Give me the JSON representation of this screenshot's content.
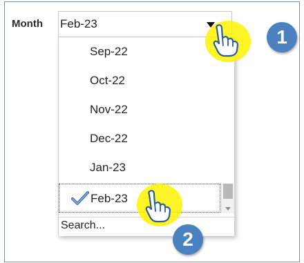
{
  "field": {
    "label": "Month",
    "selected_value": "Feb-23"
  },
  "dropdown": {
    "options": [
      {
        "label": "Sep-22",
        "selected": false
      },
      {
        "label": "Oct-22",
        "selected": false
      },
      {
        "label": "Nov-22",
        "selected": false
      },
      {
        "label": "Dec-22",
        "selected": false
      },
      {
        "label": "Jan-23",
        "selected": false
      },
      {
        "label": "Feb-23",
        "selected": true
      }
    ],
    "search_label": "Search..."
  },
  "callouts": [
    {
      "number": "1",
      "color": "#4a82bf"
    },
    {
      "number": "2",
      "color": "#4a82bf"
    }
  ],
  "colors": {
    "highlight": "#fff200",
    "checkmark": "#3a6fb0"
  },
  "icons": [
    "chevron-down-icon",
    "checkmark-icon",
    "pointer-hand-icon"
  ]
}
